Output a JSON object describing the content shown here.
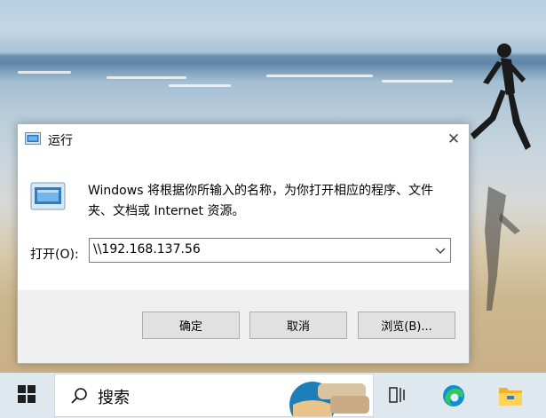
{
  "dialog": {
    "title": "运行",
    "description": "Windows 将根据你所输入的名称，为你打开相应的程序、文件夹、文档或 Internet 资源。",
    "open_label": "打开(O):",
    "open_value": "\\\\192.168.137.56",
    "buttons": {
      "ok": "确定",
      "cancel": "取消",
      "browse": "浏览(B)..."
    },
    "close_glyph": "✕"
  },
  "taskbar": {
    "search_text": "搜索",
    "icons": [
      "windows-start-icon",
      "search-icon",
      "task-view-icon",
      "edge-browser-icon",
      "file-explorer-icon"
    ]
  },
  "colors": {
    "accent": "#0078d7",
    "dialog_bg": "#f0f0f0",
    "button_bg": "#e1e1e1",
    "taskbar_bg": "#dfe7ef"
  }
}
